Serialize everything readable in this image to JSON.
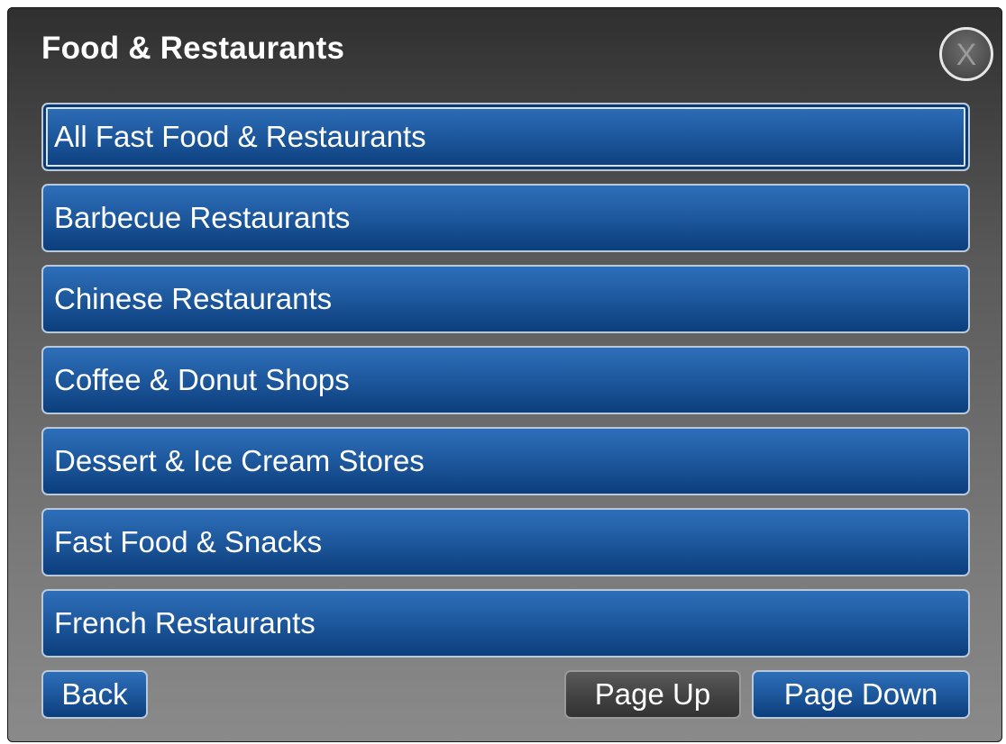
{
  "dialog": {
    "title": "Food & Restaurants",
    "close_label": "X"
  },
  "list": {
    "items": [
      {
        "label": "All Fast Food & Restaurants",
        "selected": true
      },
      {
        "label": "Barbecue Restaurants",
        "selected": false
      },
      {
        "label": "Chinese Restaurants",
        "selected": false
      },
      {
        "label": "Coffee & Donut Shops",
        "selected": false
      },
      {
        "label": "Dessert & Ice Cream Stores",
        "selected": false
      },
      {
        "label": "Fast Food & Snacks",
        "selected": false
      },
      {
        "label": "French Restaurants",
        "selected": false
      }
    ]
  },
  "footer": {
    "back_label": "Back",
    "page_up_label": "Page Up",
    "page_down_label": "Page Down"
  },
  "colors": {
    "button_blue": "#1f5aa0",
    "button_gray": "#404040",
    "panel_dark": "#2f2f2f",
    "panel_light": "#8a8a8a"
  }
}
